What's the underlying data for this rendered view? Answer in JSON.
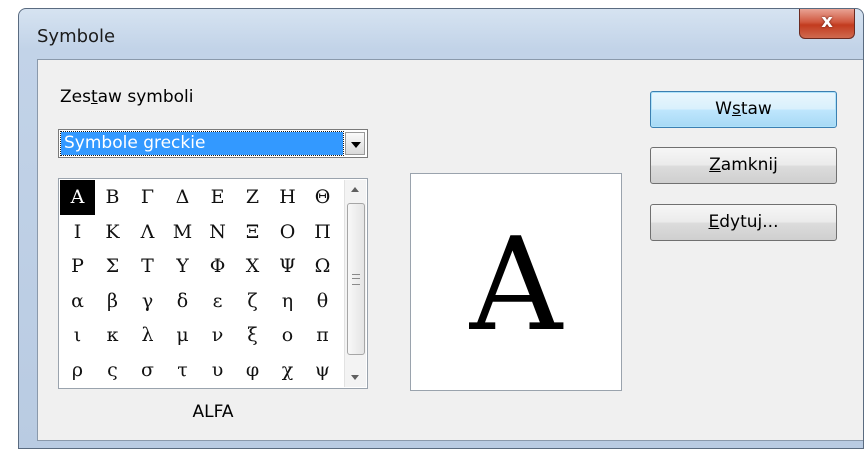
{
  "window": {
    "title": "Symbole",
    "close_label": "x"
  },
  "symbol_set": {
    "label_pre": "Zes",
    "label_accel": "t",
    "label_post": "aw symboli",
    "selected": "Symbole greckie"
  },
  "symbols": [
    [
      "Α",
      "Β",
      "Γ",
      "Δ",
      "Ε",
      "Ζ",
      "Η",
      "Θ"
    ],
    [
      "Ι",
      "Κ",
      "Λ",
      "Μ",
      "Ν",
      "Ξ",
      "Ο",
      "Π"
    ],
    [
      "Ρ",
      "Σ",
      "Τ",
      "Υ",
      "Φ",
      "Χ",
      "Ψ",
      "Ω"
    ],
    [
      "α",
      "β",
      "γ",
      "δ",
      "ε",
      "ζ",
      "η",
      "θ"
    ],
    [
      "ι",
      "κ",
      "λ",
      "μ",
      "ν",
      "ξ",
      "ο",
      "π"
    ],
    [
      "ρ",
      "ς",
      "σ",
      "τ",
      "υ",
      "φ",
      "χ",
      "ψ"
    ]
  ],
  "selected_symbol": {
    "glyph": "A",
    "name": "ALFA"
  },
  "buttons": {
    "insert": {
      "pre": "W",
      "accel": "s",
      "post": "taw"
    },
    "close": {
      "pre": "",
      "accel": "Z",
      "post": "amknij"
    },
    "edit": {
      "pre": "",
      "accel": "E",
      "post": "dytuj..."
    }
  }
}
